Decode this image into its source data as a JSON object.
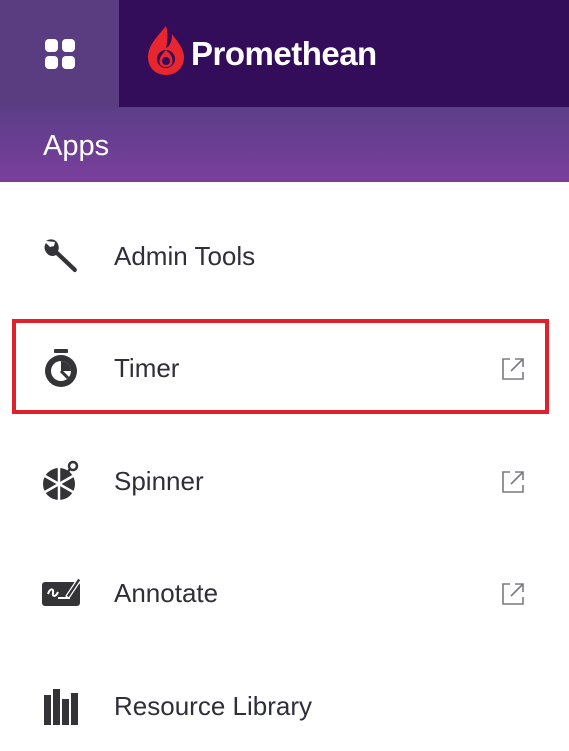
{
  "brand": {
    "name": "Promethean",
    "logo_color": "#e8262d"
  },
  "colors": {
    "top_left": "#5a3c80",
    "top_bar": "#330c5a",
    "header_from": "#5b3e88",
    "header_to": "#7a3f9d",
    "highlight": "#e0202a"
  },
  "header": {
    "title": "Apps"
  },
  "menu": {
    "items": [
      {
        "label": "Admin Tools",
        "icon": "wrench-icon",
        "external": false
      },
      {
        "label": "Timer",
        "icon": "stopwatch-icon",
        "external": true,
        "selected": true
      },
      {
        "label": "Spinner",
        "icon": "spinner-wheel-icon",
        "external": true
      },
      {
        "label": "Annotate",
        "icon": "annotate-icon",
        "external": true
      },
      {
        "label": "Resource Library",
        "icon": "books-icon",
        "external": false
      }
    ]
  }
}
